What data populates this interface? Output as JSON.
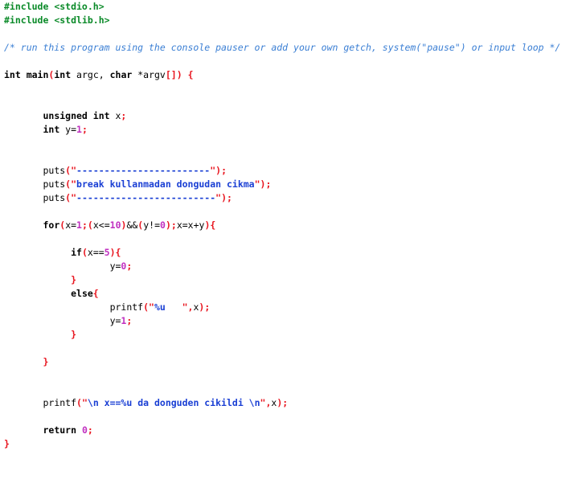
{
  "editor": {
    "language": "C",
    "background_color": "#ffffff",
    "colors": {
      "preprocessor": "#0a8a28",
      "comment": "#3b7fd4",
      "keyword": "#000000",
      "punctuation": "#e8141e",
      "string": "#1a3fd4",
      "number": "#c030c0"
    }
  },
  "code": {
    "line1_pre": "#include",
    "line1_hdr": " <stdio.h>",
    "line2_pre": "#include",
    "line2_hdr": " <stdlib.h>",
    "line4_comment": "/* run this program using the console pauser or add your own getch, system(\"pause\") or input loop */",
    "line6_kw_int": "int",
    "line6_fn": " main",
    "line6_p1": "(",
    "line6_kw_int2": "int",
    "line6_arg1": " argc, ",
    "line6_kw_char": "char",
    "line6_arg2": " *argv",
    "line6_brk": "[]",
    "line6_p2": ")",
    "line6_brace": " {",
    "line9_kw": "unsigned int",
    "line9_var": " x",
    "line9_semi": ";",
    "line10_kw": "int",
    "line10_var": " y=",
    "line10_num": "1",
    "line10_semi": ";",
    "line13_fn": "puts",
    "line13_p1": "(",
    "line13_q1": "\"",
    "line13_str": "------------------------",
    "line13_q2": "\"",
    "line13_p2": ")",
    "line13_semi": ";",
    "line14_fn": "puts",
    "line14_p1": "(",
    "line14_q1": "\"",
    "line14_str": "break kullanmadan dongudan cikma",
    "line14_q2": "\"",
    "line14_p2": ")",
    "line14_semi": ";",
    "line15_fn": "puts",
    "line15_p1": "(",
    "line15_q1": "\"",
    "line15_str": "-------------------------",
    "line15_q2": "\"",
    "line15_p2": ")",
    "line15_semi": ";",
    "line17_kw": "for",
    "line17_p1": "(",
    "line17_a": "x=",
    "line17_n1": "1",
    "line17_s1": ";",
    "line17_p2": "(",
    "line17_b": "x<=",
    "line17_n2": "10",
    "line17_p3": ")",
    "line17_amp": "&&",
    "line17_p4": "(",
    "line17_c": "y!=",
    "line17_n3": "0",
    "line17_p5": ")",
    "line17_s2": ";",
    "line17_d": "x=x+y",
    "line17_p6": ")",
    "line17_brace": "{",
    "line19_kw": "if",
    "line19_p1": "(",
    "line19_cond": "x==",
    "line19_num": "5",
    "line19_p2": ")",
    "line19_brace": "{",
    "line20_var": "y=",
    "line20_num": "0",
    "line20_semi": ";",
    "line21_brace": "}",
    "line22_kw": "else",
    "line22_brace": "{",
    "line23_fn": "printf",
    "line23_p1": "(",
    "line23_q1": "\"",
    "line23_str": "%u   ",
    "line23_q2": "\"",
    "line23_comma": ",",
    "line23_arg": "x",
    "line23_p2": ")",
    "line23_semi": ";",
    "line24_var": "y=",
    "line24_num": "1",
    "line24_semi": ";",
    "line25_brace": "}",
    "line27_brace": "}",
    "line29_fn": "printf",
    "line29_p1": "(",
    "line29_q1": "\"",
    "line29_str": "\\n x==%u da donguden cikildi \\n",
    "line29_q2": "\"",
    "line29_comma": ",",
    "line29_arg": "x",
    "line29_p2": ")",
    "line29_semi": ";",
    "line31_kw": "return",
    "line31_sp": " ",
    "line31_num": "0",
    "line31_semi": ";",
    "line32_brace": "}"
  }
}
